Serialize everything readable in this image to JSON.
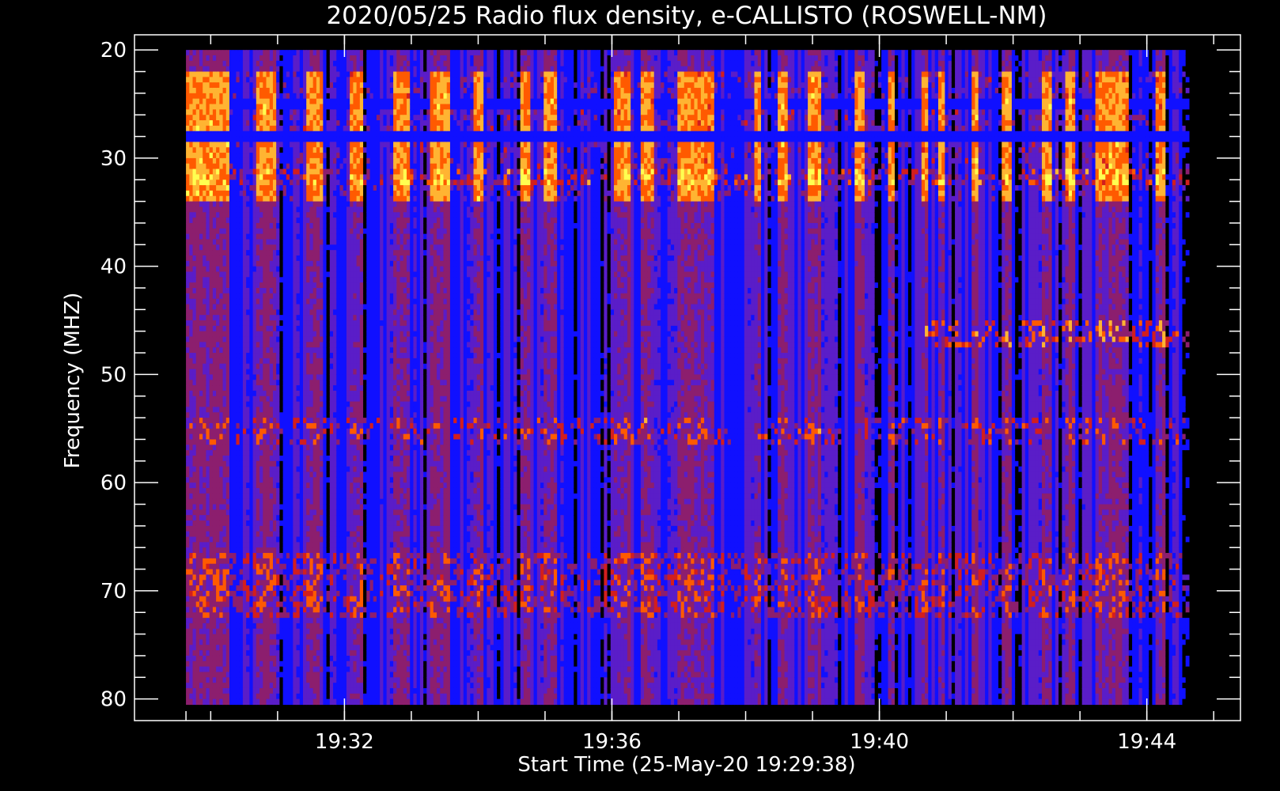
{
  "chart_data": {
    "type": "heatmap",
    "title": "2020/05/25  Radio flux density, e-CALLISTO (ROSWELL-NM)",
    "xlabel": "Start Time (25-May-20 19:29:38)",
    "ylabel": "Frequency (MHZ)",
    "x_tick_labels": [
      "19:32",
      "19:36",
      "19:40",
      "19:44"
    ],
    "x_ticks_minutes": [
      2.37,
      6.37,
      10.37,
      14.37
    ],
    "x_range_minutes": [
      -0.77,
      15.77
    ],
    "x_data_range_minutes": [
      0.0,
      15.0
    ],
    "y_tick_labels": [
      "20",
      "30",
      "40",
      "50",
      "60",
      "70",
      "80"
    ],
    "y_ticks": [
      20,
      30,
      40,
      50,
      60,
      70,
      80
    ],
    "ylim": [
      18.6,
      82
    ],
    "y_data_range": [
      20,
      80.5
    ],
    "y_inverted": true,
    "colormap": [
      "#000000",
      "#1010ff",
      "#5a1dc8",
      "#8c1e6e",
      "#d21e1e",
      "#ff5a00",
      "#ffb432",
      "#ffff50"
    ],
    "intensity_note": "intensity stripes vary by time; strong bursts near 22-33 MHz, interference lines near 31, 46, 55, 67-70, 72.5-73.5 MHz",
    "bright_time_bands_minutes": [
      [
        0.0,
        0.65
      ],
      [
        1.05,
        1.35
      ],
      [
        1.8,
        2.05
      ],
      [
        2.45,
        2.65
      ],
      [
        3.1,
        3.35
      ],
      [
        3.65,
        3.95
      ],
      [
        4.3,
        4.45
      ],
      [
        5.0,
        5.15
      ],
      [
        5.35,
        5.55
      ],
      [
        6.4,
        6.65
      ],
      [
        6.8,
        7.0
      ],
      [
        7.35,
        7.9
      ],
      [
        8.5,
        8.6
      ],
      [
        8.85,
        9.0
      ],
      [
        9.3,
        9.5
      ],
      [
        10.0,
        10.15
      ],
      [
        10.5,
        10.6
      ],
      [
        11.0,
        11.1
      ],
      [
        11.25,
        11.35
      ],
      [
        11.75,
        11.85
      ],
      [
        12.2,
        12.35
      ],
      [
        12.8,
        12.95
      ],
      [
        13.15,
        13.3
      ],
      [
        13.6,
        14.1
      ],
      [
        14.5,
        14.65
      ]
    ]
  }
}
